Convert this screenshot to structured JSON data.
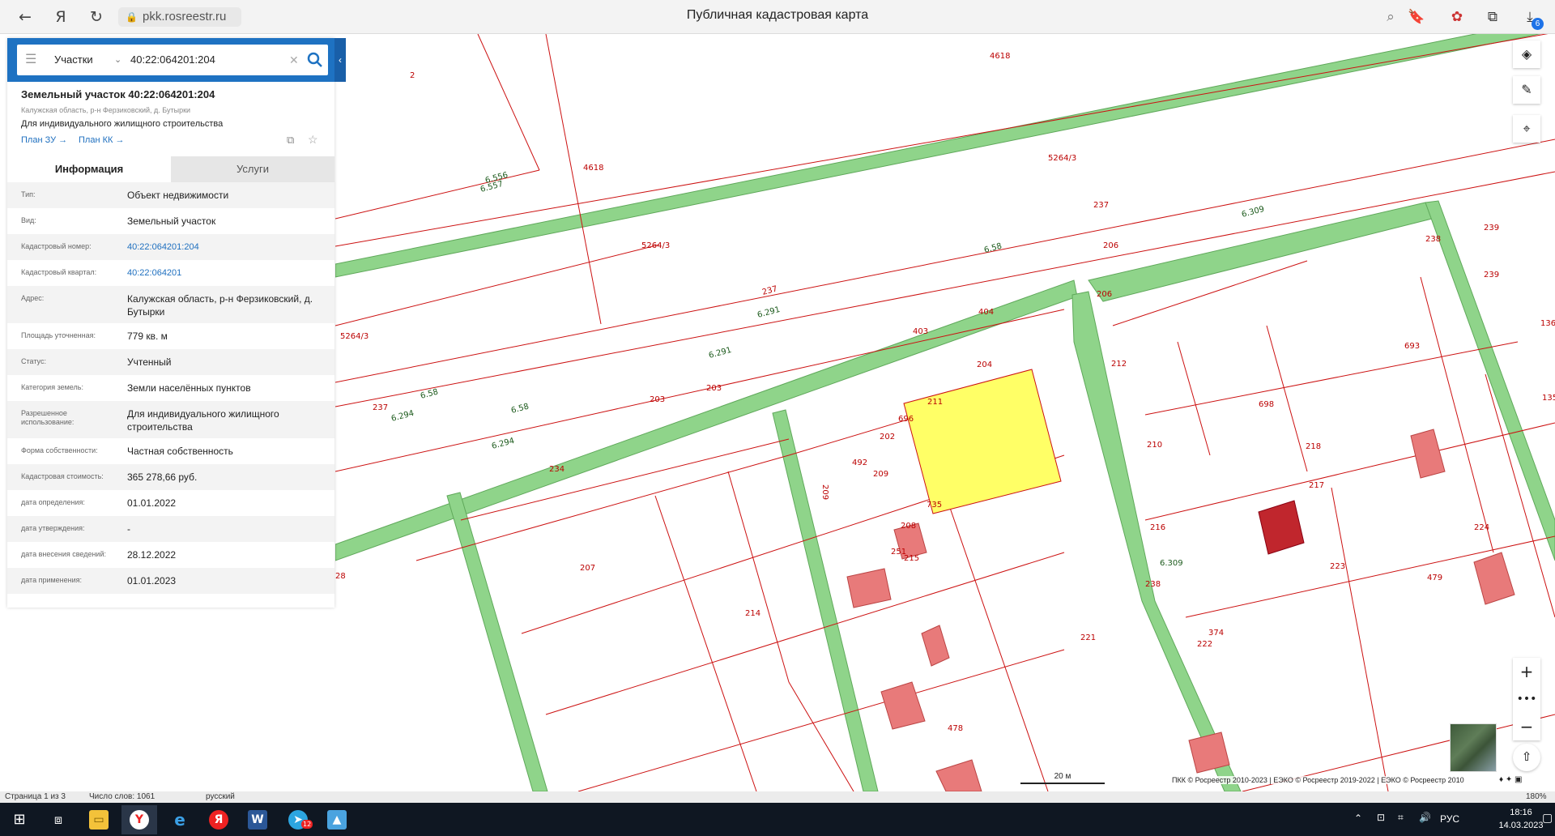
{
  "browser": {
    "url": "pkk.rosreestr.ru",
    "title": "Публичная кадастровая карта",
    "download_badge": "6"
  },
  "search": {
    "type_label": "Участки",
    "query": "40:22:064201:204"
  },
  "object": {
    "title": "Земельный участок 40:22:064201:204",
    "address_short": "Калужская область, р-н Ферзиковский, д. Бутырки",
    "use": "Для индивидуального жилищного строительства",
    "plan_zu": "План ЗУ",
    "plan_kk": "План КК"
  },
  "tabs": {
    "info": "Информация",
    "services": "Услуги"
  },
  "properties": [
    {
      "key": "Тип:",
      "value": "Объект недвижимости"
    },
    {
      "key": "Вид:",
      "value": "Земельный участок"
    },
    {
      "key": "Кадастровый номер:",
      "value": "40:22:064201:204",
      "link": true
    },
    {
      "key": "Кадастровый квартал:",
      "value": "40:22:064201",
      "link": true
    },
    {
      "key": "Адрес:",
      "value": "Калужская область, р-н Ферзиковский, д. Бутырки"
    },
    {
      "key": "Площадь уточненная:",
      "value": "779 кв. м"
    },
    {
      "key": "Статус:",
      "value": "Учтенный"
    },
    {
      "key": "Категория земель:",
      "value": "Земли населённых пунктов"
    },
    {
      "key": "Разрешенное использование:",
      "value": "Для индивидуального жилищного строительства"
    },
    {
      "key": "Форма собственности:",
      "value": "Частная собственность"
    },
    {
      "key": "Кадастровая стоимость:",
      "value": "365 278,66 руб."
    },
    {
      "key": "дата определения:",
      "value": "01.01.2022"
    },
    {
      "key": "дата утверждения:",
      "value": "-"
    },
    {
      "key": "дата внесения сведений:",
      "value": "28.12.2022"
    },
    {
      "key": "дата применения:",
      "value": "01.01.2023"
    }
  ],
  "map": {
    "scale_label": "20 м",
    "copyright": "ПКК © Росреестр 2010-2023 | ЕЭКО © Росреестр 2019-2022 | ЕЭКО © Росреестр 2010",
    "colors": {
      "parcel_line": "#cc1111",
      "road": "#8fd48a",
      "selected": "#ffff66",
      "building": "#e87a7a",
      "building_dark": "#c0262d"
    },
    "labels": [
      "2",
      "4618",
      "4618",
      "5264/3",
      "5264/3",
      "5264/3",
      "6.556",
      "6.557",
      "6.309",
      "6.58",
      "6.294",
      "6.58",
      "6.291",
      "6.291",
      "6.294",
      "6.58",
      "237",
      "237",
      "237",
      "238",
      "239",
      "239",
      "206",
      "206",
      "404",
      "403",
      "693",
      "212",
      "211",
      "698",
      "204",
      "203",
      "203",
      "696",
      "202",
      "492",
      "209",
      "210",
      "218",
      "479",
      "234",
      "735",
      "208",
      "217",
      "207",
      "251",
      "215",
      "216",
      "224",
      "223",
      "214",
      "478",
      "374",
      "222",
      "221",
      "238",
      "6.309",
      "136",
      "135",
      "209",
      "28"
    ]
  },
  "word_status": {
    "page": "Страница 1 из 3",
    "words": "Число слов: 1061",
    "lang": "русский",
    "zoom": "180%"
  },
  "taskbar": {
    "lang": "РУС",
    "time": "18:16",
    "date": "14.03.2023",
    "telegram_badge": "12"
  }
}
